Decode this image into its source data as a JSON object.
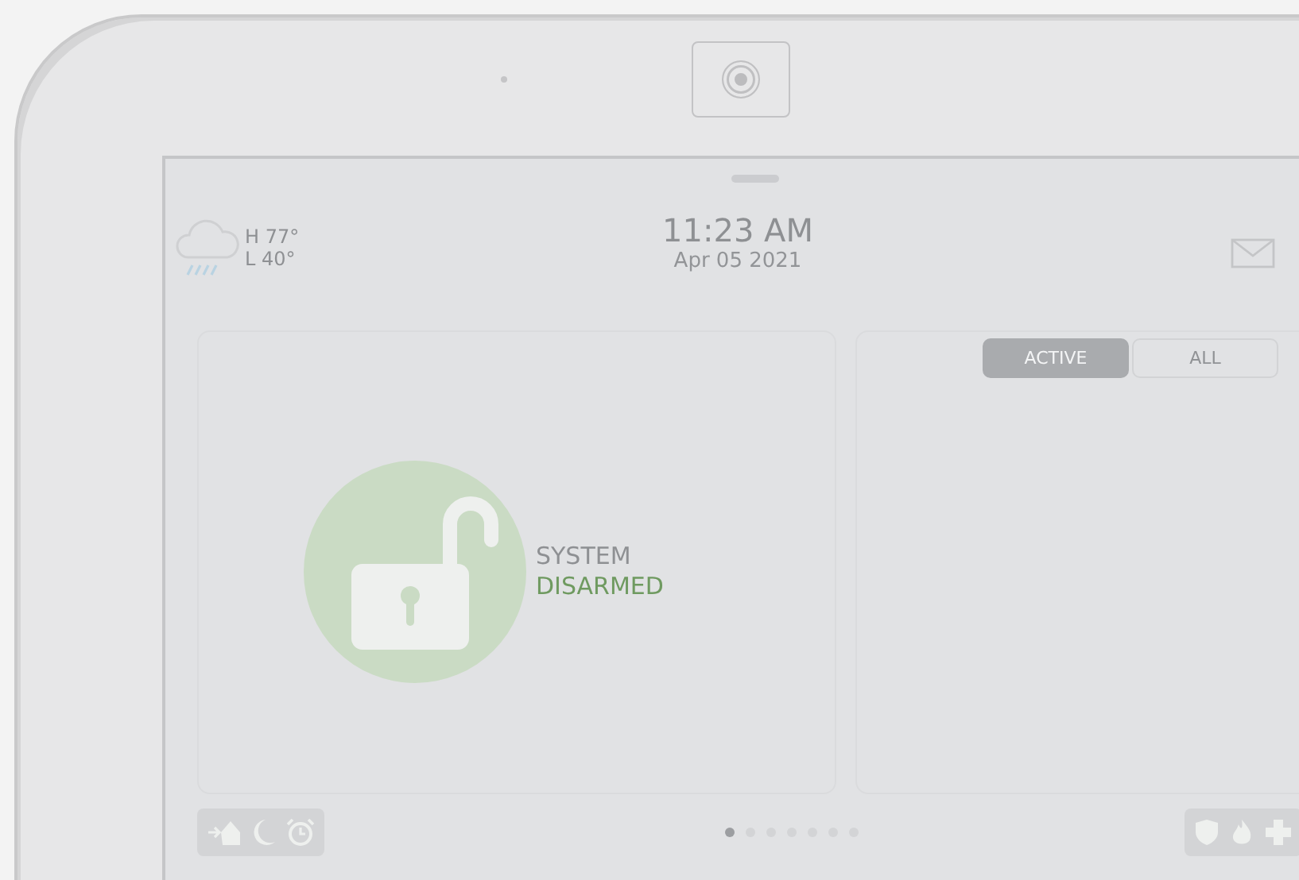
{
  "weather": {
    "high": "H 77°",
    "low": "L 40°"
  },
  "clock": {
    "time": "11:23 AM",
    "date": "Apr 05 2021"
  },
  "tabs": [
    {
      "label": "ACTIVE",
      "selected": true
    },
    {
      "label": "ALL",
      "selected": false
    }
  ],
  "status": {
    "line1": "SYSTEM",
    "line2": "DISARMED",
    "armed": false
  },
  "page_dots": [
    {
      "selected": true
    },
    {
      "selected": false
    },
    {
      "selected": false
    },
    {
      "selected": false
    },
    {
      "selected": false
    },
    {
      "selected": false
    },
    {
      "selected": false
    }
  ]
}
